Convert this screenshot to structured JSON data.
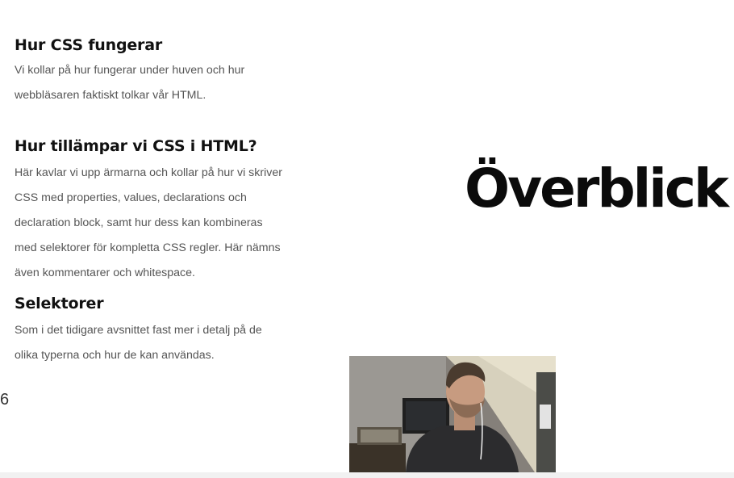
{
  "sections": [
    {
      "heading": "Hur CSS fungerar",
      "lines": [
        "Vi kollar på hur fungerar under huven och hur",
        "webbläsaren faktiskt tolkar vår HTML."
      ]
    },
    {
      "heading": "Hur tillämpar vi CSS i HTML?",
      "lines": [
        "Här kavlar vi upp ärmarna och kollar på hur vi skriver",
        "CSS med properties, values, declarations och",
        "declaration block, samt hur dess kan kombineras",
        "med selektorer för kompletta CSS regler. Här nämns",
        "även kommentarer och whitespace."
      ]
    },
    {
      "heading": "Selektorer",
      "lines": [
        "Som i det tidigare avsnittet fast mer i detalj på de",
        "olika typerna och hur de kan användas."
      ]
    }
  ],
  "slide": {
    "title": "Överblick",
    "page_number": "6"
  },
  "webcam": {
    "icon": "person-webcam-icon"
  }
}
